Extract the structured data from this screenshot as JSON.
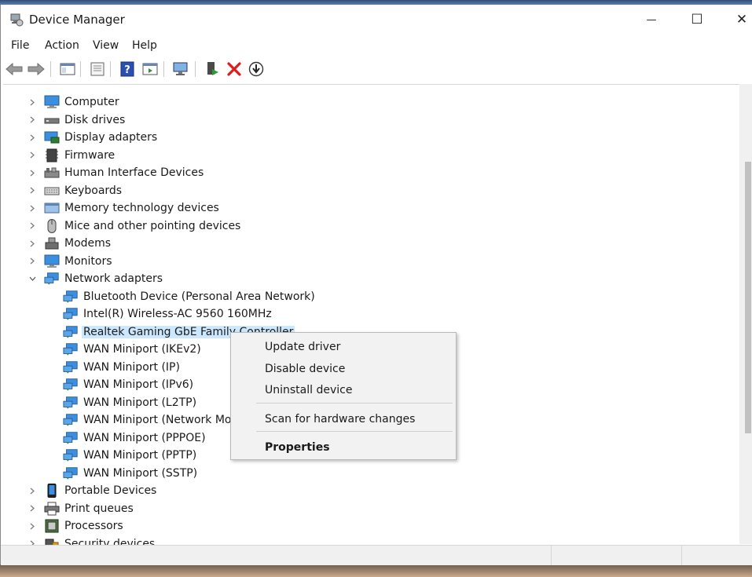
{
  "window": {
    "title": "Device Manager",
    "controls": {
      "minimize": "—",
      "maximize": "☐",
      "close": "✕"
    }
  },
  "menu": [
    "File",
    "Action",
    "View",
    "Help"
  ],
  "toolbar": {
    "icons": [
      "back-arrow-icon",
      "forward-arrow-icon",
      "show-hide-console-tree-icon",
      "properties-icon",
      "help-icon",
      "action-pane-icon",
      "scan-hardware-icon",
      "update-driver-icon",
      "uninstall-icon",
      "disable-device-icon"
    ]
  },
  "tree": {
    "categories_top": [
      {
        "label": "Computer",
        "icon": "computer-icon"
      },
      {
        "label": "Disk drives",
        "icon": "disk-drive-icon"
      },
      {
        "label": "Display adapters",
        "icon": "display-adapter-icon"
      },
      {
        "label": "Firmware",
        "icon": "firmware-icon"
      },
      {
        "label": "Human Interface Devices",
        "icon": "hid-icon"
      },
      {
        "label": "Keyboards",
        "icon": "keyboard-icon"
      },
      {
        "label": "Memory technology devices",
        "icon": "memory-icon"
      },
      {
        "label": "Mice and other pointing devices",
        "icon": "mouse-icon"
      },
      {
        "label": "Modems",
        "icon": "modem-icon"
      },
      {
        "label": "Monitors",
        "icon": "monitor-icon"
      }
    ],
    "network": {
      "label": "Network adapters",
      "children": [
        "Bluetooth Device (Personal Area Network)",
        "Intel(R) Wireless-AC 9560 160MHz",
        "Realtek Gaming GbE Family Controller",
        "WAN Miniport (IKEv2)",
        "WAN Miniport (IP)",
        "WAN Miniport (IPv6)",
        "WAN Miniport (L2TP)",
        "WAN Miniport (Network Mor",
        "WAN Miniport (PPPOE)",
        "WAN Miniport (PPTP)",
        "WAN Miniport (SSTP)"
      ]
    },
    "categories_bottom": [
      {
        "label": "Portable Devices",
        "icon": "portable-device-icon"
      },
      {
        "label": "Print queues",
        "icon": "printer-icon"
      },
      {
        "label": "Processors",
        "icon": "processor-icon"
      },
      {
        "label": "Security devices",
        "icon": "security-device-icon"
      }
    ]
  },
  "context_menu": {
    "items": [
      "Update driver",
      "Disable device",
      "Uninstall device"
    ],
    "scan": "Scan for hardware changes",
    "properties": "Properties"
  },
  "colors": {
    "selection": "#cce8ff",
    "accent": "#1a73c8"
  }
}
